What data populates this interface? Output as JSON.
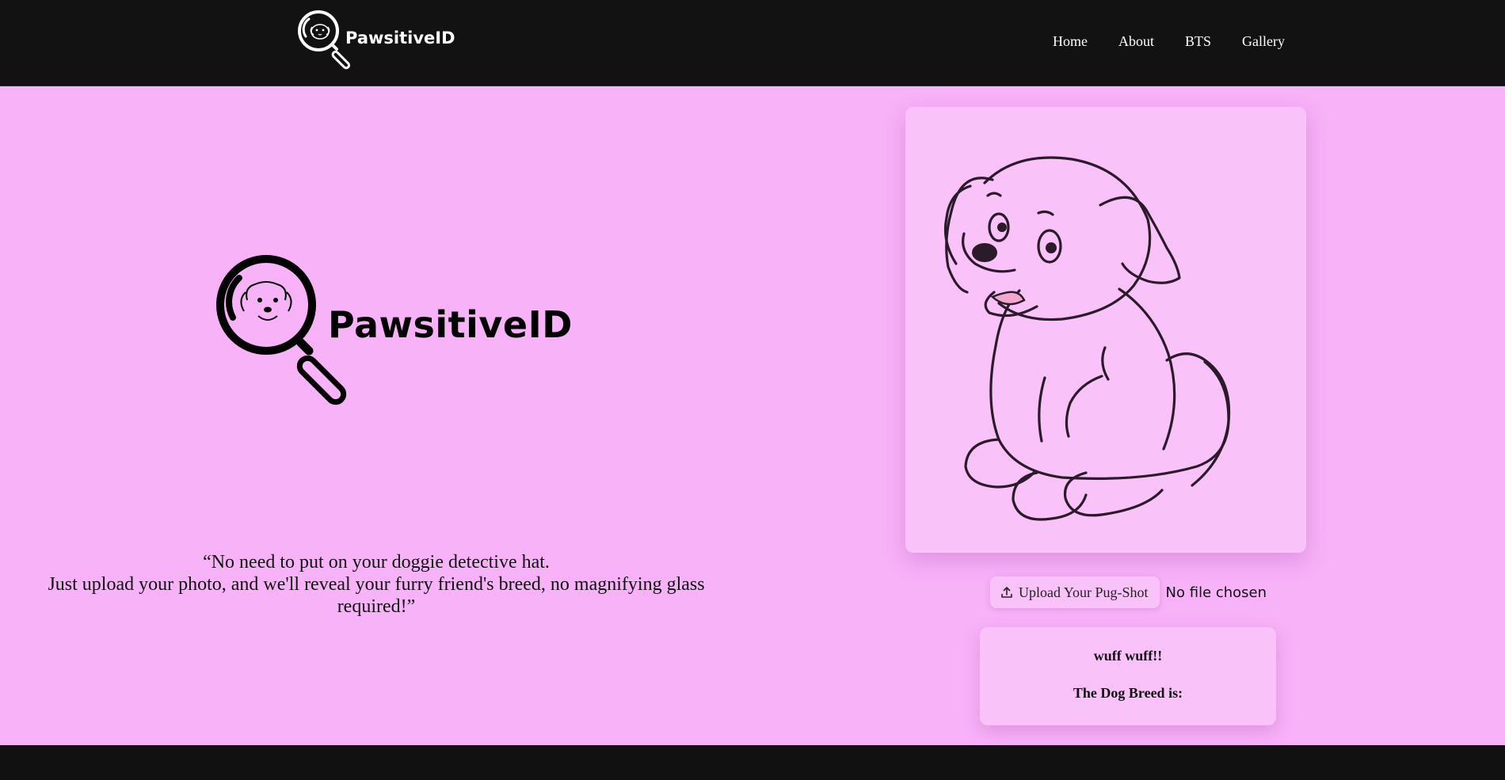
{
  "header": {
    "brand": "PawsitiveID",
    "nav": [
      "Home",
      "About",
      "BTS",
      "Gallery"
    ]
  },
  "hero": {
    "brand": "PawsitiveID",
    "quote_line1": "“No need to put on your doggie detective hat.",
    "quote_line2": "Just upload your photo, and we'll reveal your furry friend's breed, no magnifying glass required!”"
  },
  "upload": {
    "button_label": "Upload Your Pug-Shot",
    "file_status": "No file chosen",
    "icon": "upload-icon"
  },
  "result": {
    "greeting": "wuff wuff!!",
    "breed_label": "The Dog Breed is:"
  },
  "colors": {
    "background": "#f8b2f8",
    "card": "#f9c2f9",
    "header": "#121212"
  }
}
